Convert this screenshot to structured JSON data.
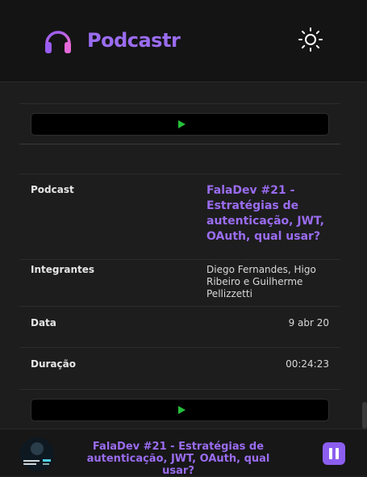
{
  "header": {
    "brand": "Podcastr",
    "logo_icon": "headphones-icon",
    "theme_icon": "sun-icon"
  },
  "episode": {
    "rows": [
      {
        "label": "Podcast",
        "value": "FalaDev #21 - Estratégias de autenticação, JWT, OAuth, qual usar?"
      },
      {
        "label": "Integrantes",
        "value": "Diego Fernandes, Higo Ribeiro e Guilherme Pellizzetti"
      },
      {
        "label": "Data",
        "value": "9 abr 20"
      },
      {
        "label": "Duração",
        "value": "00:24:23"
      }
    ],
    "play_icon": "play-icon"
  },
  "player": {
    "title": "FalaDev #21 - Estratégias de autenticação, JWT, OAuth, qual usar?",
    "pause_icon": "pause-icon"
  },
  "colors": {
    "accent": "#9a6cf0",
    "play": "#25c13b",
    "background": "#1d1d1d",
    "header": "#141414"
  }
}
